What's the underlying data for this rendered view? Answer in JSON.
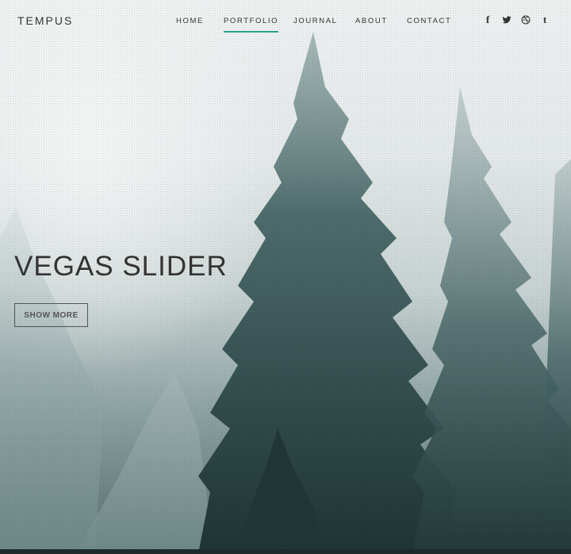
{
  "header": {
    "logo": "TEMPUS",
    "nav": [
      {
        "label": "HOME",
        "active": false
      },
      {
        "label": "PORTFOLIO",
        "active": true
      },
      {
        "label": "JOURNAL",
        "active": false
      },
      {
        "label": "ABOUT",
        "active": false
      },
      {
        "label": "CONTACT",
        "active": false
      }
    ],
    "social": [
      "facebook-icon",
      "twitter-icon",
      "dribbble-icon",
      "tumblr-icon"
    ]
  },
  "hero": {
    "title": "VEGAS SLIDER",
    "button_label": "SHOW MORE"
  },
  "colors": {
    "accent": "#28a28a",
    "text": "#333333"
  }
}
